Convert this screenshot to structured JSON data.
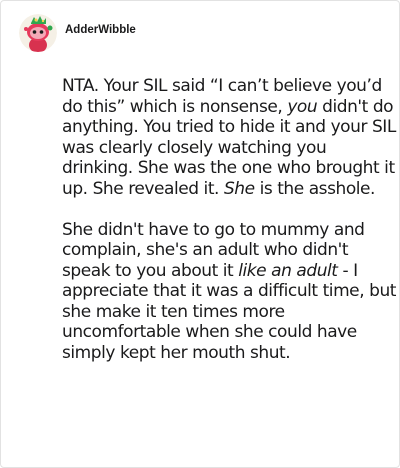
{
  "post": {
    "username": "AdderWibble",
    "avatar_icon": "snoo-avatar-icon",
    "colors": {
      "avatar_bg": "#f5f0e6",
      "avatar_head": "#e63a5c",
      "avatar_accent": "#2fa84f"
    },
    "paragraphs": [
      {
        "segments": [
          {
            "text": "NTA. Your SIL said “I can’t believe you’d do this” which is nonsense, ",
            "italic": false
          },
          {
            "text": "you",
            "italic": true
          },
          {
            "text": " didn't do anything. You tried to hide it and your SIL was clearly closely watching you drinking. She was the one who brought it up. She revealed it. ",
            "italic": false
          },
          {
            "text": "She",
            "italic": true
          },
          {
            "text": " is the asshole.",
            "italic": false
          }
        ]
      },
      {
        "segments": [
          {
            "text": "She didn't have to go to mummy and complain, she's an adult who didn't speak to you about it ",
            "italic": false
          },
          {
            "text": "like an adult",
            "italic": true
          },
          {
            "text": " - I appreciate that it was a difficult time, but she make it ten times more uncomfortable when she could have simply kept her mouth shut.",
            "italic": false
          }
        ]
      }
    ]
  }
}
